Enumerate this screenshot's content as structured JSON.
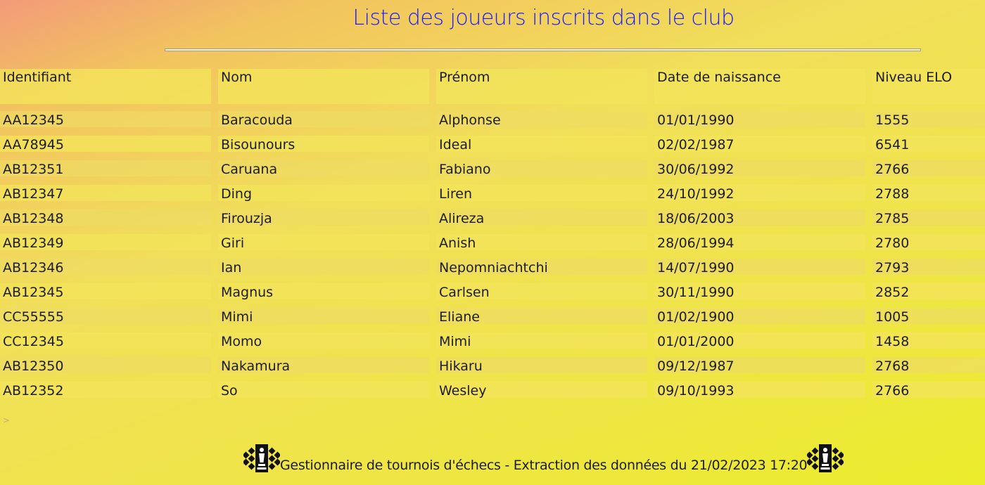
{
  "page": {
    "title": "Liste des joueurs inscrits dans le club",
    "caret": ">"
  },
  "table": {
    "headers": [
      "Identifiant",
      "Nom",
      "Prénom",
      "Date de naissance",
      "Niveau ELO"
    ],
    "rows": [
      [
        "AA12345",
        "Baracouda",
        "Alphonse",
        "01/01/1990",
        "1555"
      ],
      [
        "AA78945",
        "Bisounours",
        "Ideal",
        "02/02/1987",
        "6541"
      ],
      [
        "AB12351",
        "Caruana",
        "Fabiano",
        "30/06/1992",
        "2766"
      ],
      [
        "AB12347",
        "Ding",
        "Liren",
        "24/10/1992",
        "2788"
      ],
      [
        "AB12348",
        "Firouzja",
        "Alireza",
        "18/06/2003",
        "2785"
      ],
      [
        "AB12349",
        "Giri",
        "Anish",
        "28/06/1994",
        "2780"
      ],
      [
        "AB12346",
        "Ian",
        "Nepomniachtchi",
        "14/07/1990",
        "2793"
      ],
      [
        "AB12345",
        "Magnus",
        "Carlsen",
        "30/11/1990",
        "2852"
      ],
      [
        "CC55555",
        "Mimi",
        "Eliane",
        "01/02/1900",
        "1005"
      ],
      [
        "CC12345",
        "Momo",
        "Mimi",
        "01/01/2000",
        "1458"
      ],
      [
        "AB12350",
        "Nakamura",
        "Hikaru",
        "09/12/1987",
        "2768"
      ],
      [
        "AB12352",
        "So",
        "Wesley",
        "09/10/1993",
        "2766"
      ]
    ]
  },
  "footer": {
    "text": "Gestionnaire de tournois d'échecs - Extraction des données du 21/02/2023 17:20",
    "icon_left": "chess-logo-icon",
    "icon_right": "chess-logo-icon"
  },
  "colors": {
    "title": "#1a1aff",
    "background_top_left": "#f39a7a",
    "background_bottom_right": "#ecec2c"
  }
}
